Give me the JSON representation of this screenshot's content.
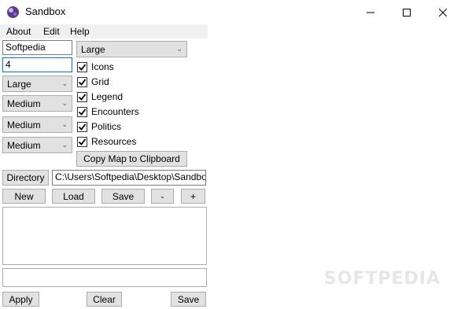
{
  "window": {
    "title": "Sandbox",
    "icons": {
      "app": "sandbox-app-icon",
      "minimize": "minimize-icon",
      "maximize": "maximize-icon",
      "close": "close-icon"
    }
  },
  "menu": {
    "about": "About",
    "edit": "Edit",
    "help": "Help"
  },
  "left": {
    "name_value": "Softpedia",
    "number_value": "4",
    "combo1": "Large",
    "combo2": "Medium",
    "combo3": "Medium",
    "combo4": "Medium"
  },
  "map_size": "Large",
  "checkboxes": {
    "icons": "Icons",
    "grid": "Grid",
    "legend": "Legend",
    "encounters": "Encounters",
    "politics": "Politics",
    "resources": "Resources"
  },
  "copy_map_label": "Copy Map to Clipboard",
  "directory": {
    "label": "Directory",
    "path": "C:\\Users\\Softpedia\\Desktop\\Sandbo"
  },
  "file_buttons": {
    "new": "New",
    "load": "Load",
    "save": "Save",
    "minus": "-",
    "plus": "+"
  },
  "bottom_buttons": {
    "apply": "Apply",
    "clear": "Clear",
    "save": "Save"
  },
  "watermark": "SOFTPEDIA"
}
